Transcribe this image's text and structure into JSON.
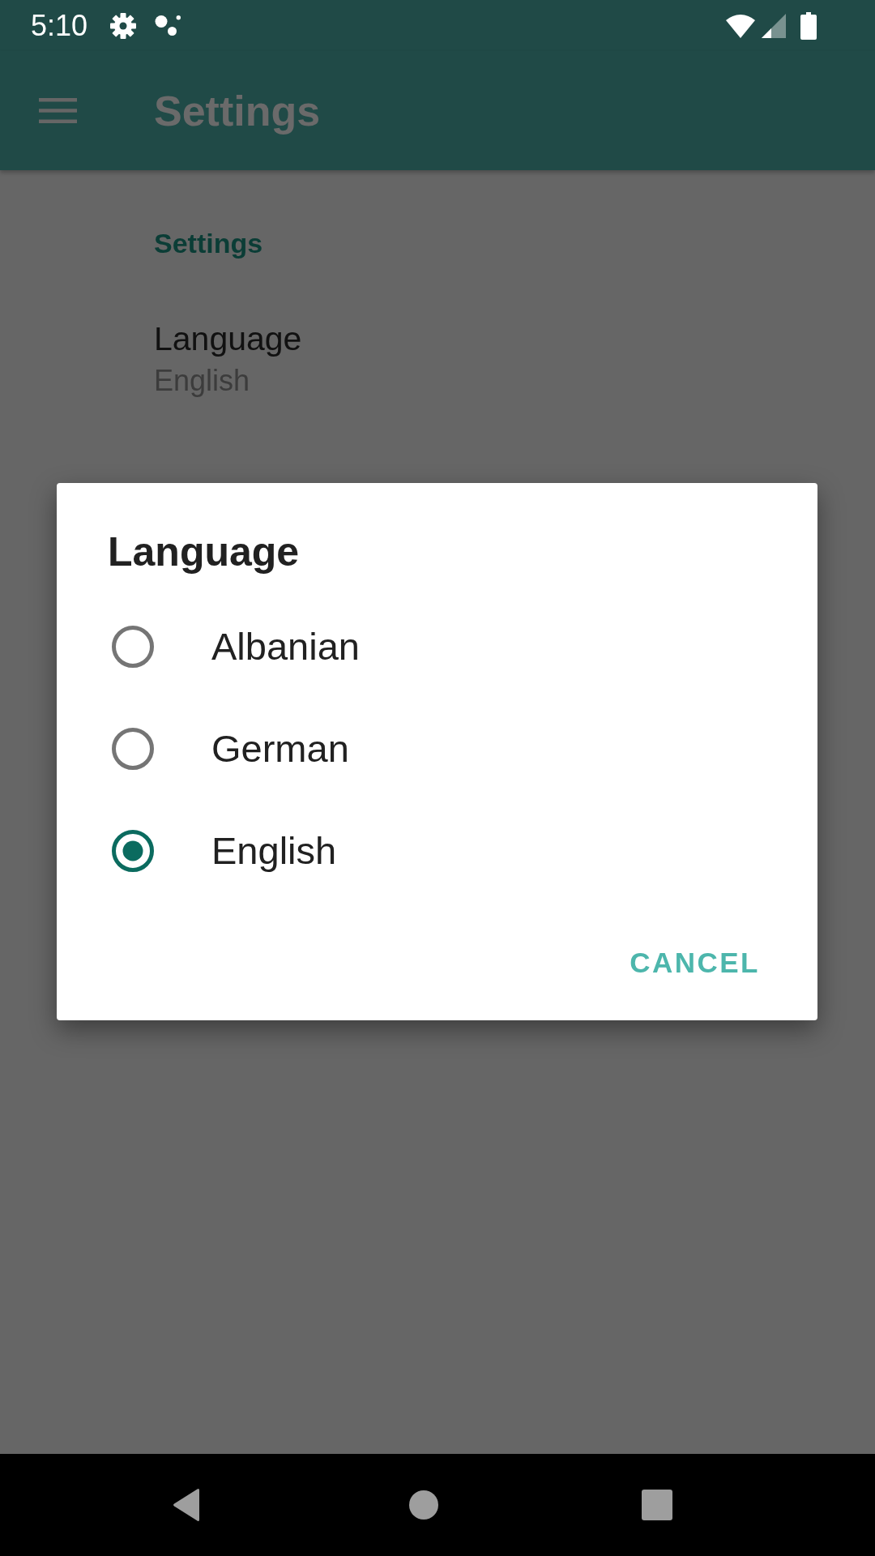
{
  "status_bar": {
    "time": "5:10"
  },
  "app_bar": {
    "title": "Settings"
  },
  "preferences": {
    "category": "Settings",
    "items": [
      {
        "title": "Language",
        "summary": "English"
      }
    ]
  },
  "dialog": {
    "title": "Language",
    "options": [
      {
        "label": "Albanian",
        "selected": false
      },
      {
        "label": "German",
        "selected": false
      },
      {
        "label": "English",
        "selected": true
      }
    ],
    "buttons": [
      "CANCEL"
    ]
  }
}
